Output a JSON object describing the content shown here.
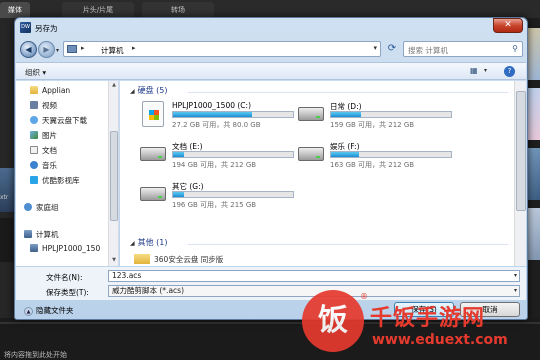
{
  "background": {
    "tabs": [
      "媒体",
      "片头/片尾",
      "转场"
    ],
    "bottom_text": "将内容拖到此处开始",
    "side_text": "xtr"
  },
  "dialog": {
    "title": "另存为",
    "app_icon": "DW",
    "close_glyph": "✕",
    "address_path": "计算机",
    "search_placeholder": "搜索 计算机",
    "toolbar": {
      "organize": "组织 ▾"
    },
    "nav_items": [
      {
        "label": "Applian",
        "icon": "folder-icon"
      },
      {
        "label": "视频",
        "icon": "video-icon"
      },
      {
        "label": "天翼云盘下载",
        "icon": "cloud-folder-icon"
      },
      {
        "label": "图片",
        "icon": "pictures-icon"
      },
      {
        "label": "文档",
        "icon": "documents-icon"
      },
      {
        "label": "音乐",
        "icon": "music-icon"
      },
      {
        "label": "优酷影视库",
        "icon": "youku-icon"
      },
      {
        "label": "家庭组",
        "icon": "homegroup-icon"
      },
      {
        "label": "计算机",
        "icon": "computer-icon"
      },
      {
        "label": "HPLJP1000_150",
        "icon": "drive-icon"
      }
    ],
    "groups": {
      "hard_disks": "硬盘 (5)",
      "other": "其他 (1)"
    },
    "drives": [
      {
        "name": "HPLJP1000_1500 (C:)",
        "info": "27.2 GB 可用，共 80.0 GB",
        "used_fraction": 0.66
      },
      {
        "name": "日常 (D:)",
        "info": "159 GB 可用，共 212 GB",
        "used_fraction": 0.25
      },
      {
        "name": "文档 (E:)",
        "info": "194 GB 可用，共 212 GB",
        "used_fraction": 0.09
      },
      {
        "name": "娱乐 (F:)",
        "info": "163 GB 可用，共 212 GB",
        "used_fraction": 0.23
      },
      {
        "name": "其它 (G:)",
        "info": "196 GB 可用，共 215 GB",
        "used_fraction": 0.09
      }
    ],
    "other_item": "360安全云盘 同步版",
    "filename_label": "文件名(N):",
    "filename_value": "123.acs",
    "filetype_label": "保存类型(T):",
    "filetype_value": "威力酷剪脚本 (*.acs)",
    "hide_folders": "隐藏文件夹",
    "save_button": "保存(S)",
    "cancel_button": "取消"
  },
  "watermark": {
    "logo": "饭",
    "name": "千饭手游网",
    "url": "www.eduext.com",
    "reg": "®"
  },
  "colors": {
    "accent": "#1d8fd3",
    "group_header": "#1e3a8a",
    "watermark": "#e63a2e"
  }
}
